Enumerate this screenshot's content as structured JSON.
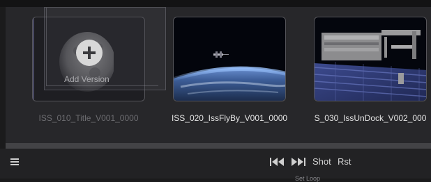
{
  "versions": [
    {
      "caption": "ISS_010_Title_V001_0000",
      "state": "dimmed",
      "overlay_label": "Add Version"
    },
    {
      "caption": "ISS_020_IssFlyBy_V001_0000",
      "state": "normal"
    },
    {
      "caption": "S_030_IssUnDock_V002_000",
      "state": "normal"
    }
  ],
  "toolbar": {
    "menu_icon": "hamburger-menu-icon",
    "prev_icon": "skip-back-icon",
    "next_icon": "skip-forward-icon",
    "shot_label": "Shot",
    "rst_label": "Rst",
    "sub_label": "Set Loop"
  },
  "colors": {
    "panel": "#27272a",
    "toolbar": "#222224",
    "scrollbar": "#434346"
  }
}
